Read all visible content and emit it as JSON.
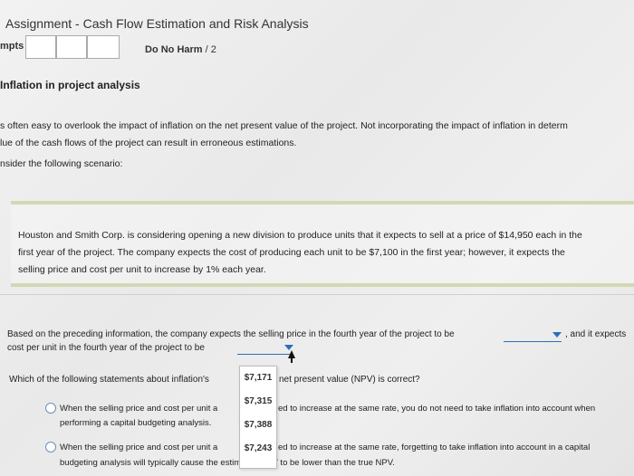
{
  "header": {
    "title": "Assignment - Cash Flow Estimation and Risk Analysis",
    "pts_label": "mpts",
    "harm_label": "Do No Harm",
    "harm_value": "/ 2"
  },
  "section": {
    "heading": "Inflation in project analysis",
    "intro_line1": "s often easy to overlook the impact of inflation on the net present value of the project. Not incorporating the impact of inflation in determ",
    "intro_line2": "lue of the cash flows of the project can result in erroneous estimations.",
    "consider": "nsider the following scenario:"
  },
  "scenario": {
    "line1": "Houston and Smith Corp. is considering opening a new division to produce units that it expects to sell at a price of $14,950 each in the",
    "line2": "first year of the project. The company expects the cost of producing each unit to be $7,100 in the first year; however, it expects the",
    "line3": "selling price and cost per unit to increase by 1% each year."
  },
  "question1": {
    "line1": "Based on the preceding information, the company expects the selling price in the fourth year of the project to be",
    "line1_tail": ", and it expects",
    "line2": "cost per unit in the fourth year of the project to be"
  },
  "dropdown": {
    "options": [
      "$7,171",
      "$7,315",
      "$7,388",
      "$7,243"
    ]
  },
  "question2": {
    "stem_start": "Which of the following statements about inflation's",
    "stem_end": "net present value (NPV) is correct?",
    "option1_a": "When the selling price and cost per unit a",
    "option1_b": "ed to increase at the same rate, you do not need to take inflation into account when",
    "option1_line2": "performing a capital budgeting analysis.",
    "option2_a": "When the selling price and cost per unit a",
    "option2_b": "ed to increase at the same rate, forgetting to take inflation into account in a capital",
    "option2_line2": "budgeting analysis will typically cause the estimated NPV to be lower than the true NPV."
  }
}
